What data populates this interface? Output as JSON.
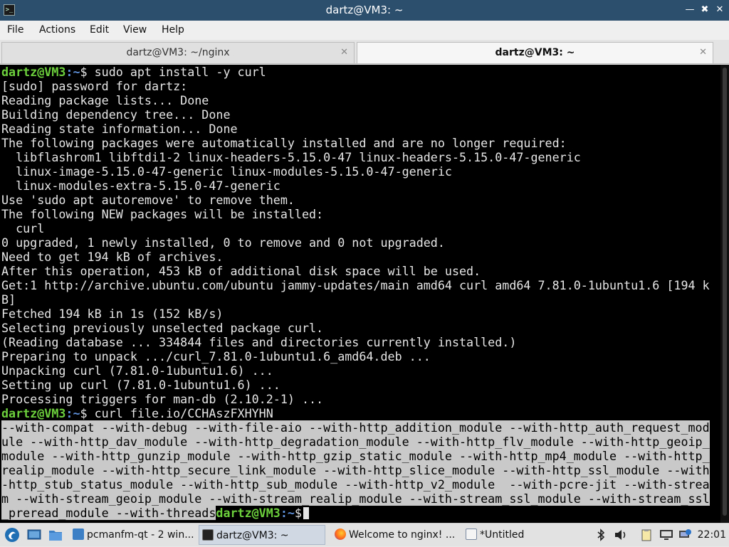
{
  "window": {
    "title": "dartz@VM3: ~",
    "app_icon": "terminal-icon",
    "controls": [
      "minimize-icon",
      "maximize-icon",
      "close-icon"
    ]
  },
  "menu": [
    "File",
    "Actions",
    "Edit",
    "View",
    "Help"
  ],
  "tabs": [
    {
      "label": "dartz@VM3: ~/nginx",
      "active": false
    },
    {
      "label": "dartz@VM3: ~",
      "active": true
    }
  ],
  "terminal": {
    "prompt_user": "dartz@VM3",
    "prompt_path": ":~",
    "prompt_char": "$",
    "lines": [
      {
        "prompt": true,
        "cmd": " sudo apt install -y curl"
      },
      {
        "text": "[sudo] password for dartz:"
      },
      {
        "text": "Reading package lists... Done"
      },
      {
        "text": "Building dependency tree... Done"
      },
      {
        "text": "Reading state information... Done"
      },
      {
        "text": "The following packages were automatically installed and are no longer required:"
      },
      {
        "text": "  libflashrom1 libftdi1-2 linux-headers-5.15.0-47 linux-headers-5.15.0-47-generic"
      },
      {
        "text": "  linux-image-5.15.0-47-generic linux-modules-5.15.0-47-generic"
      },
      {
        "text": "  linux-modules-extra-5.15.0-47-generic"
      },
      {
        "text": "Use 'sudo apt autoremove' to remove them."
      },
      {
        "text": "The following NEW packages will be installed:"
      },
      {
        "text": "  curl"
      },
      {
        "text": "0 upgraded, 1 newly installed, 0 to remove and 0 not upgraded."
      },
      {
        "text": "Need to get 194 kB of archives."
      },
      {
        "text": "After this operation, 453 kB of additional disk space will be used."
      },
      {
        "text": "Get:1 http://archive.ubuntu.com/ubuntu jammy-updates/main amd64 curl amd64 7.81.0-1ubuntu1.6 [194 k"
      },
      {
        "text": "B]"
      },
      {
        "text": "Fetched 194 kB in 1s (152 kB/s)"
      },
      {
        "text": "Selecting previously unselected package curl."
      },
      {
        "text": "(Reading database ... 334844 files and directories currently installed.)"
      },
      {
        "text": "Preparing to unpack .../curl_7.81.0-1ubuntu1.6_amd64.deb ..."
      },
      {
        "text": "Unpacking curl (7.81.0-1ubuntu1.6) ..."
      },
      {
        "text": "Setting up curl (7.81.0-1ubuntu1.6) ..."
      },
      {
        "text": "Processing triggers for man-db (2.10.2-1) ..."
      },
      {
        "prompt": true,
        "cmd": " curl file.io/CCHAszFXHYHN"
      },
      {
        "sel": "--with-compat --with-debug --with-file-aio --with-http_addition_module --with-http_auth_request_mod"
      },
      {
        "sel": "ule --with-http_dav_module --with-http_degradation_module --with-http_flv_module --with-http_geoip_"
      },
      {
        "sel": "module --with-http_gunzip_module --with-http_gzip_static_module --with-http_mp4_module --with-http_"
      },
      {
        "sel": "realip_module --with-http_secure_link_module --with-http_slice_module --with-http_ssl_module --with"
      },
      {
        "sel": "-http_stub_status_module --with-http_sub_module --with-http_v2_module  --with-pcre-jit --with-strea"
      },
      {
        "sel": "m --with-stream_geoip_module --with-stream_realip_module --with-stream_ssl_module --with-stream_ssl"
      },
      {
        "sel": "_preread_module --with-threads",
        "trailing_prompt": true
      }
    ]
  },
  "taskbar": {
    "launchers": [
      "start-menu-icon",
      "show-desktop-icon",
      "file-manager-icon"
    ],
    "tasks": [
      {
        "label": "pcmanfm-qt - 2 win...",
        "icon": "folder-icon",
        "active": false
      },
      {
        "label": "dartz@VM3: ~",
        "icon": "terminal-icon",
        "active": true
      },
      {
        "label": "Welcome to nginx! ...",
        "icon": "firefox-icon",
        "active": false
      },
      {
        "label": "*Untitled",
        "icon": "text-editor-icon",
        "active": false
      }
    ],
    "tray": [
      "bluetooth-icon",
      "volume-icon",
      "clipboard-icon",
      "display-icon",
      "network-icon"
    ],
    "clock": "22:01"
  },
  "colors": {
    "titlebar": "#2d4f6e",
    "prompt_user": "#6ccf3c",
    "prompt_path": "#5e8fd9",
    "selection": "#c9c9c9"
  }
}
